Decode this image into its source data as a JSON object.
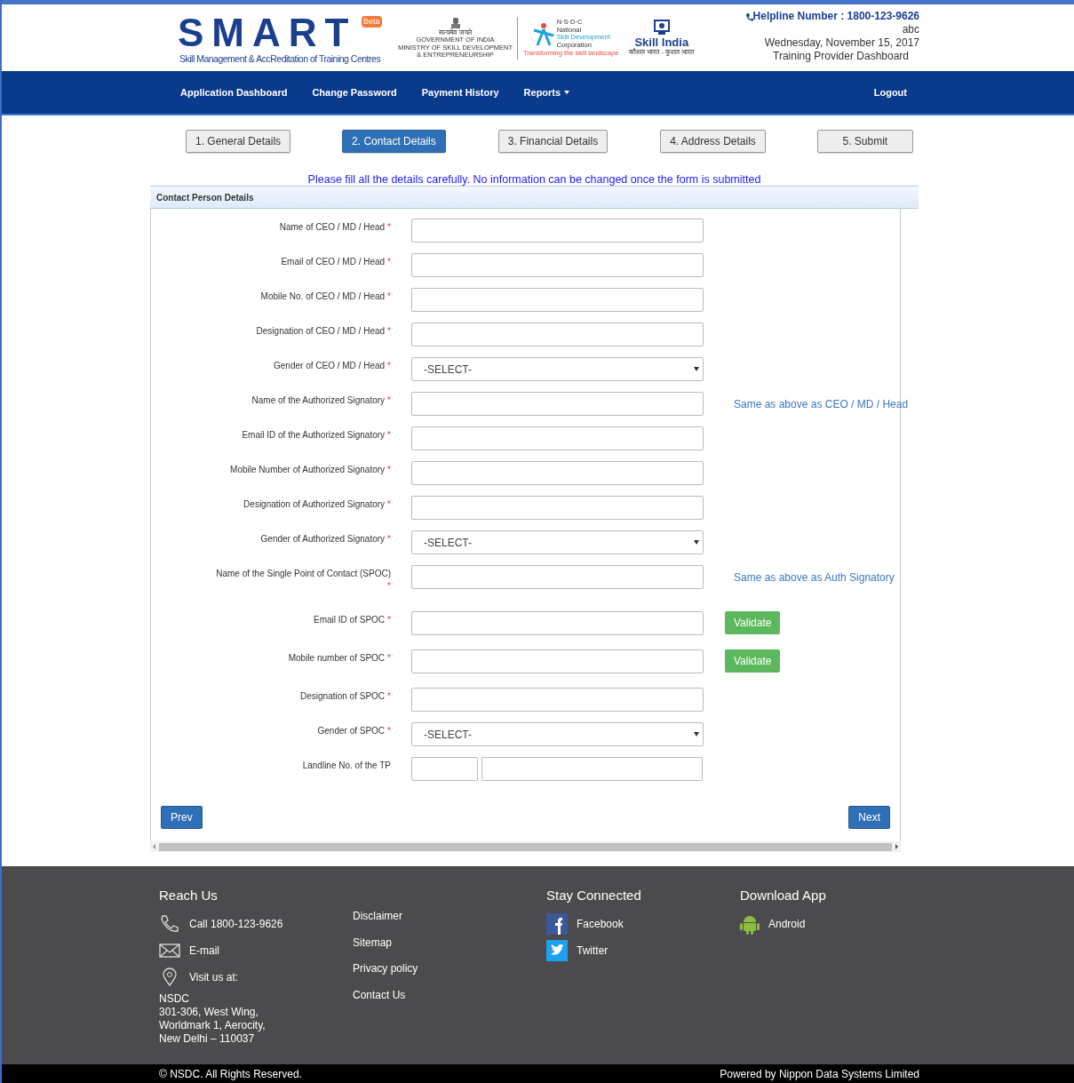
{
  "header": {
    "logo": {
      "letters": "SMART",
      "badge": "Beta",
      "tagline": "Skill Management & AccReditation of Training Centres"
    },
    "partners": [
      {
        "kind": "emblem",
        "lines": [
          "सत्यमेव जयते",
          "GOVERNMENT OF INDIA",
          "MINISTRY OF SKILL DEVELOPMENT",
          "& ENTREPRENEURSHIP"
        ]
      },
      {
        "kind": "nsdc",
        "lines": [
          "N·S·D·C",
          "National",
          "Skill Development",
          "Corporation",
          "Transforming the skill landscape"
        ]
      },
      {
        "kind": "skillindia",
        "lines": [
          "Skill India",
          "कौशल भारत - कुशल भारत"
        ]
      }
    ],
    "helpline": "Helpline Number : 1800-123-9626",
    "user": "abc",
    "date": "Wednesday, November 15, 2017",
    "role": "Training Provider Dashboard"
  },
  "nav": {
    "items": [
      {
        "label": "Application Dashboard",
        "dropdown": false
      },
      {
        "label": "Change Password",
        "dropdown": false
      },
      {
        "label": "Payment History",
        "dropdown": false
      },
      {
        "label": "Reports",
        "dropdown": true
      }
    ],
    "logout": "Logout"
  },
  "steps": [
    {
      "label": "1. General Details",
      "selected": false
    },
    {
      "label": "2. Contact Details",
      "selected": true
    },
    {
      "label": "3. Financial Details",
      "selected": false
    },
    {
      "label": "4. Address Details",
      "selected": false
    },
    {
      "label": "5. Submit",
      "selected": false
    }
  ],
  "notice": "Please fill all the details carefully. No information can be changed once the form is submitted",
  "panel": {
    "title": "Contact Person Details",
    "fields": [
      {
        "label": "Name of CEO / MD / Head",
        "mark": "*",
        "kind": "text"
      },
      {
        "label": "Email of CEO / MD / Head",
        "mark": "*",
        "kind": "text"
      },
      {
        "label": "Mobile No. of CEO / MD / Head",
        "mark": "*",
        "kind": "text"
      },
      {
        "label": "Designation of CEO / MD / Head",
        "mark": "*",
        "kind": "text"
      },
      {
        "label": "Gender of CEO / MD / Head",
        "mark": "*",
        "kind": "select",
        "value": "-SELECT-"
      },
      {
        "label": "Name of the Authorized Signatory",
        "mark": "*",
        "kind": "text",
        "link": "Same as above as CEO / MD / Head"
      },
      {
        "label": "Email ID of the Authorized Signatory",
        "mark": "*",
        "kind": "text"
      },
      {
        "label": "Mobile Number of Authorized Signatory",
        "mark": "*",
        "kind": "text"
      },
      {
        "label": "Designation of Authorized Signatory",
        "mark": "*",
        "kind": "text"
      },
      {
        "label": "Gender of Authorized Signatory",
        "mark": "*",
        "kind": "select",
        "value": "-SELECT-"
      },
      {
        "label": "Name of the Single Point of Contact (SPOC)",
        "mark": "*",
        "kind": "text",
        "link": "Same as above as Auth Signatory"
      },
      {
        "label": "Email ID of SPOC",
        "mark": "*",
        "kind": "text",
        "button": "Validate"
      },
      {
        "label": "Mobile number of SPOC",
        "mark": "*",
        "kind": "text",
        "button": "Validate"
      },
      {
        "label": "Designation of SPOC",
        "mark": "*",
        "kind": "text"
      },
      {
        "label": "Gender of SPOC",
        "mark": "*",
        "kind": "select",
        "value": "-SELECT-"
      },
      {
        "label": "Landline No. of the TP",
        "kind": "landline"
      }
    ],
    "prev": "Prev",
    "next": "Next"
  },
  "footer": {
    "reach": {
      "title": "Reach Us",
      "items": [
        {
          "kind": "phone",
          "label": "Call 1800-123-9626"
        },
        {
          "kind": "mail",
          "label": "E-mail"
        },
        {
          "kind": "pin",
          "label": "Visit us at:"
        }
      ],
      "address": [
        "NSDC",
        "301-306, West Wing,",
        "Worldmark 1, Aerocity,",
        "New Delhi – 110037"
      ]
    },
    "links": [
      "Disclaimer",
      "Sitemap",
      "Privacy policy",
      "Contact Us"
    ],
    "social": {
      "title": "Stay Connected",
      "items": [
        {
          "kind": "facebook",
          "label": "Facebook"
        },
        {
          "kind": "twitter",
          "label": "Twitter"
        }
      ]
    },
    "app": {
      "title": "Download App",
      "items": [
        {
          "kind": "android",
          "label": "Android"
        }
      ]
    },
    "copyright": "© NSDC. All Rights Reserved.",
    "powered": "Powered by Nippon Data Systems Limited"
  }
}
